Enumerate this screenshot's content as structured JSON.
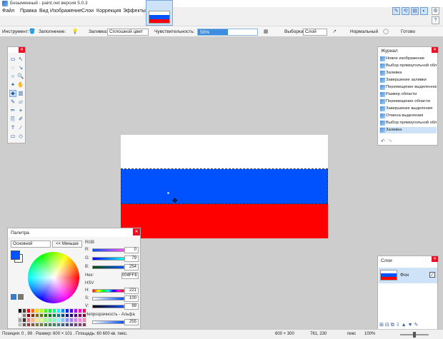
{
  "window": {
    "title": "Безымянный - paint.net версия 5.0.3"
  },
  "menu": [
    "Файл",
    "Правка",
    "Вид",
    "Изображение",
    "Слои",
    "Коррекция",
    "Эффекты"
  ],
  "toolbar": {
    "tool_label": "Инструмент:",
    "fill_mode_label": "Заполнение:",
    "fill_label": "Заливка:",
    "fill_value": "Сплошной цвет",
    "sensitivity_label": "Чувствительность:",
    "sensitivity_value": "50%",
    "sensitivity_fraction": 0.5,
    "selection_label": "Выборка",
    "layer_value": "Слой",
    "blend_value": "Нормальный",
    "done_label": "Готово"
  },
  "history": {
    "title": "Журнал",
    "items": [
      {
        "label": "Новое изображение",
        "state": "normal"
      },
      {
        "label": "Выбор прямоугольной области",
        "state": "normal"
      },
      {
        "label": "Заливка",
        "state": "normal"
      },
      {
        "label": "Завершение заливки",
        "state": "normal"
      },
      {
        "label": "Перемещение выделенной области",
        "state": "normal"
      },
      {
        "label": "Размер области",
        "state": "normal"
      },
      {
        "label": "Перемещение области",
        "state": "normal"
      },
      {
        "label": "Завершение выделения",
        "state": "normal"
      },
      {
        "label": "Отмена выделения",
        "state": "normal"
      },
      {
        "label": "Выбор прямоугольной области",
        "state": "normal"
      },
      {
        "label": "Заливка",
        "state": "selected"
      }
    ]
  },
  "layers": {
    "title": "Слои",
    "items": [
      {
        "name": "Фон",
        "visible": true
      }
    ]
  },
  "palette": {
    "title": "Палитра",
    "mode": "Основной",
    "less_button": "<< Меньше",
    "rgb_label": "RGB",
    "r_label": "R:",
    "r": "0",
    "g_label": "G:",
    "g": "79",
    "b_label": "B:",
    "b": "254",
    "hex_label": "Hex:",
    "hex": "004FFE",
    "hsv_label": "HSV",
    "h_label": "H:",
    "h": "221",
    "s_label": "S:",
    "s": "100",
    "v_label": "V:",
    "v": "99",
    "alpha_label": "Непрозрачность - Альфа",
    "alpha": "255",
    "primary_color": "#0052fe",
    "secondary_color": "#ffffff"
  },
  "canvas": {
    "colors": [
      "#ffffff",
      "#0052fe",
      "#ff0000"
    ]
  },
  "status": {
    "position": "Позиция: 0 , 99 . Размер: 600 × 101 . Площадь: 60 600 кв. пикс.",
    "image_size": "600 × 300",
    "cursor": "761, 230",
    "units": "пикс",
    "zoom": "100%"
  }
}
